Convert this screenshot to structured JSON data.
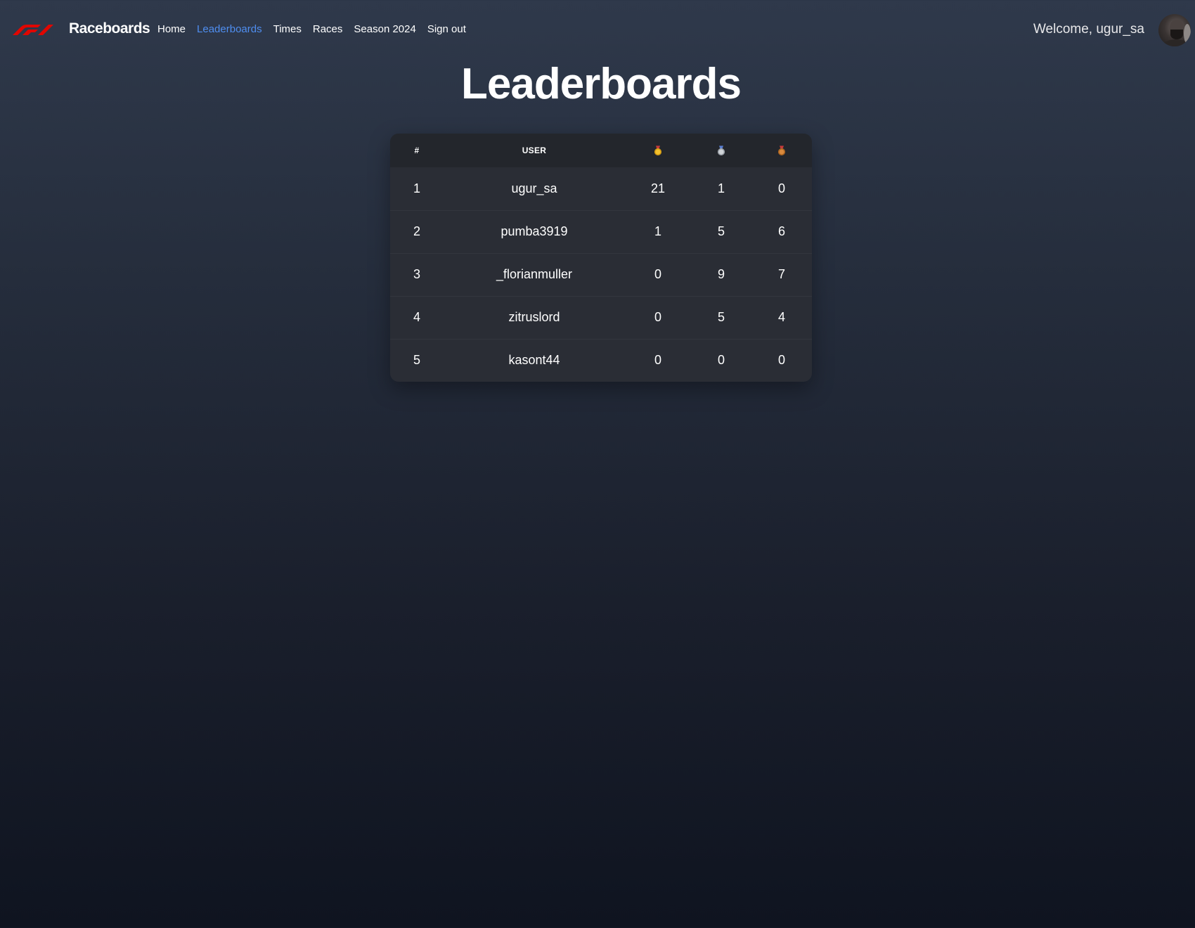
{
  "brand": {
    "name": "Raceboards",
    "logo_icon": "f1-logo-icon",
    "logo_color": "#e10600"
  },
  "nav": {
    "items": [
      {
        "label": "Home",
        "active": false
      },
      {
        "label": "Leaderboards",
        "active": true
      },
      {
        "label": "Times",
        "active": false
      },
      {
        "label": "Races",
        "active": false
      },
      {
        "label": "Season 2024",
        "active": false
      },
      {
        "label": "Sign out",
        "active": false
      }
    ],
    "active_color": "#4f8ef0"
  },
  "user": {
    "welcome": "Welcome, ugur_sa",
    "avatar_icon": "user-avatar"
  },
  "page": {
    "title": "Leaderboards"
  },
  "leaderboard": {
    "columns": [
      "#",
      "USER",
      "gold-medal-icon",
      "silver-medal-icon",
      "bronze-medal-icon"
    ],
    "header_rank": "#",
    "header_user": "USER",
    "rows": [
      {
        "rank": "1",
        "user": "ugur_sa",
        "gold": "21",
        "silver": "1",
        "bronze": "0"
      },
      {
        "rank": "2",
        "user": "pumba3919",
        "gold": "1",
        "silver": "5",
        "bronze": "6"
      },
      {
        "rank": "3",
        "user": "_florianmuller",
        "gold": "0",
        "silver": "9",
        "bronze": "7"
      },
      {
        "rank": "4",
        "user": "zitruslord",
        "gold": "0",
        "silver": "5",
        "bronze": "4"
      },
      {
        "rank": "5",
        "user": "kasont44",
        "gold": "0",
        "silver": "0",
        "bronze": "0"
      }
    ]
  }
}
